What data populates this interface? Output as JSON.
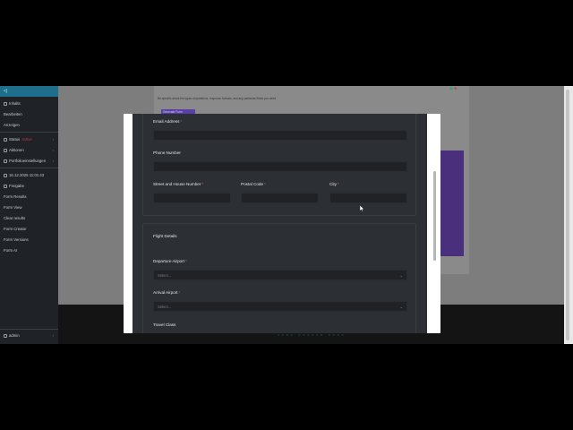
{
  "sidebar": {
    "top_label": "<|",
    "items": [
      {
        "label": "Inhalts"
      },
      {
        "label": "Bearbeiten"
      },
      {
        "label": "Anzeigen"
      },
      {
        "label": "Status",
        "badge": "Active"
      },
      {
        "label": "Aktionen"
      },
      {
        "label": "Portfolioeinstellungen"
      },
      {
        "label": "16.12.2025 11:01:43"
      },
      {
        "label": "Freigabe"
      },
      {
        "label": "Form Results"
      },
      {
        "label": "Form View"
      },
      {
        "label": "Clear results"
      },
      {
        "label": "Form Creator"
      },
      {
        "label": "Form Versions"
      },
      {
        "label": "Form AI"
      }
    ],
    "user": "admin"
  },
  "background": {
    "note": "Be specific about the types of questions, response formats, and any particular fields you need",
    "button": "Generate Form"
  },
  "form": {
    "email_label": "Email Address",
    "phone_label": "Phone Number",
    "street_label": "Street and House Number",
    "postal_label": "Postal Code",
    "city_label": "City",
    "flight_section": "Flight Details",
    "departure_label": "Departure Airport",
    "departure_placeholder": "Select...",
    "arrival_label": "Arrival Airport",
    "arrival_placeholder": "Select...",
    "class_label": "Travel Class",
    "required_mark": "*"
  },
  "colors": {
    "modal_bg": "#2c2f34",
    "field_bg": "#202226",
    "required": "#e05a5a",
    "sidebar_bg": "#1f2327",
    "accent": "#5b3fa8"
  }
}
